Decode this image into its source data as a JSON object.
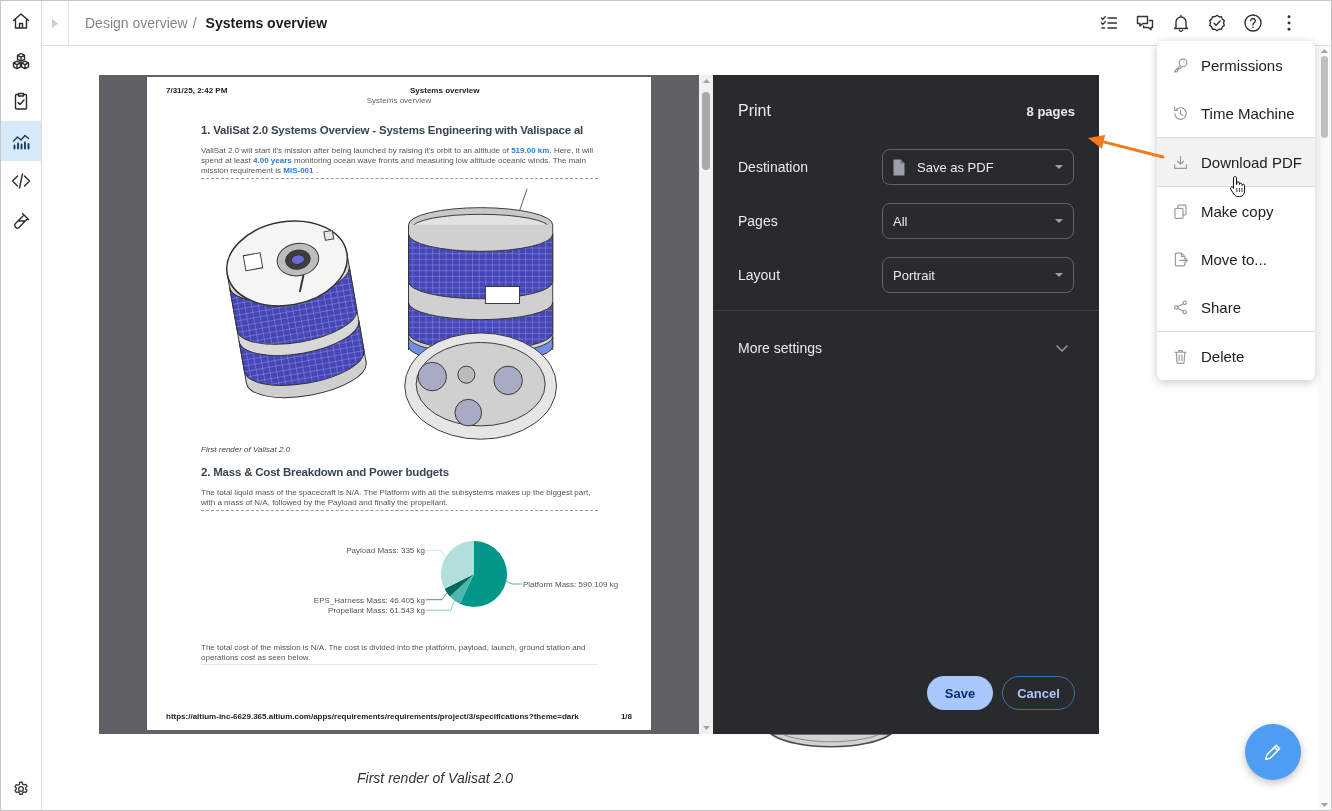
{
  "sidebar": {
    "items": [
      {
        "selected": false
      },
      {
        "selected": false
      },
      {
        "selected": false
      },
      {
        "selected": true
      },
      {
        "selected": false
      },
      {
        "selected": false
      }
    ]
  },
  "breadcrumb": {
    "parent": "Design overview",
    "separator": "/",
    "current": "Systems overview"
  },
  "print_preview": {
    "header_date": "7/31/25, 2:42 PM",
    "header_title": "Systems overview",
    "subtitle": "Systems overview",
    "blocks": [
      {
        "kind": "heading",
        "text": "1. ValiSat 2.0 Systems Overview - Systems Engineering with Valispace al"
      },
      {
        "kind": "paragraph",
        "dashed_rule": true,
        "text": "ValiSat 2.0 will start it's mission after being launched by raising it's orbit to an altitude of **519.00 km**. Here, it will spend at least **4.00 years** monitoring ocean wave fronts and measuring low altitude oceanic winds. The main mission requirement is **MIS-001** ."
      },
      {
        "kind": "figure",
        "caption": "First render of Valisat 2.0"
      },
      {
        "kind": "heading",
        "text": "2. Mass & Cost Breakdown and Power budgets"
      },
      {
        "kind": "paragraph",
        "dashed_rule": true,
        "text": "The total liquid mass of the spacecraft is N/A. The Platform with all the subsystems makes up the biggest part, with a mass of N/A, followed by the Payload and finally the propellant."
      },
      {
        "kind": "chart",
        "chart_data": {
          "type": "pie",
          "categories": [
            "Platform Mass: 590.109 kg",
            "Propellant Mass: 61.543 kg",
            "EPS_Harness Mass: 46.405 kg",
            "Payload Mass: 335 kg"
          ],
          "values": [
            590.109,
            61.543,
            46.405,
            335
          ]
        }
      },
      {
        "kind": "paragraph",
        "dashed_rule": false,
        "text": "The total cost of the mission is N/A. The cost is divided into the platform, payload, launch, ground station and operations cost as seen below."
      }
    ],
    "footer_url": "https://altium-inc-6629.365.altium.com/apps/requirements/requirements/project/3/specifications?theme=dark",
    "footer_page": "1/8"
  },
  "print_dialog": {
    "title": "Print",
    "page_count": "8 pages",
    "settings": [
      {
        "kind": "file",
        "label": "Destination",
        "value": "Save as PDF"
      },
      {
        "kind": "plain",
        "label": "Pages",
        "value": "All"
      },
      {
        "kind": "plain",
        "label": "Layout",
        "value": "Portrait"
      }
    ],
    "more_settings": {
      "label": "More settings",
      "expanded": false
    },
    "buttons": [
      {
        "kind": "primary",
        "label": "Save"
      },
      {
        "kind": "secondary",
        "label": "Cancel"
      }
    ]
  },
  "underlying_page": {
    "caption": "First render of Valisat 2.0"
  },
  "menu": {
    "groups": [
      {
        "items": [
          {
            "label": "Permissions",
            "highlighted": false
          },
          {
            "label": "Time Machine",
            "highlighted": false
          }
        ]
      },
      {
        "items": [
          {
            "label": "Download PDF",
            "highlighted": true
          }
        ]
      },
      {
        "items": [
          {
            "label": "Make copy",
            "highlighted": false
          },
          {
            "label": "Move to...",
            "highlighted": false
          },
          {
            "label": "Share",
            "highlighted": false
          }
        ]
      },
      {
        "items": [
          {
            "label": "Delete",
            "highlighted": false
          }
        ]
      }
    ]
  }
}
